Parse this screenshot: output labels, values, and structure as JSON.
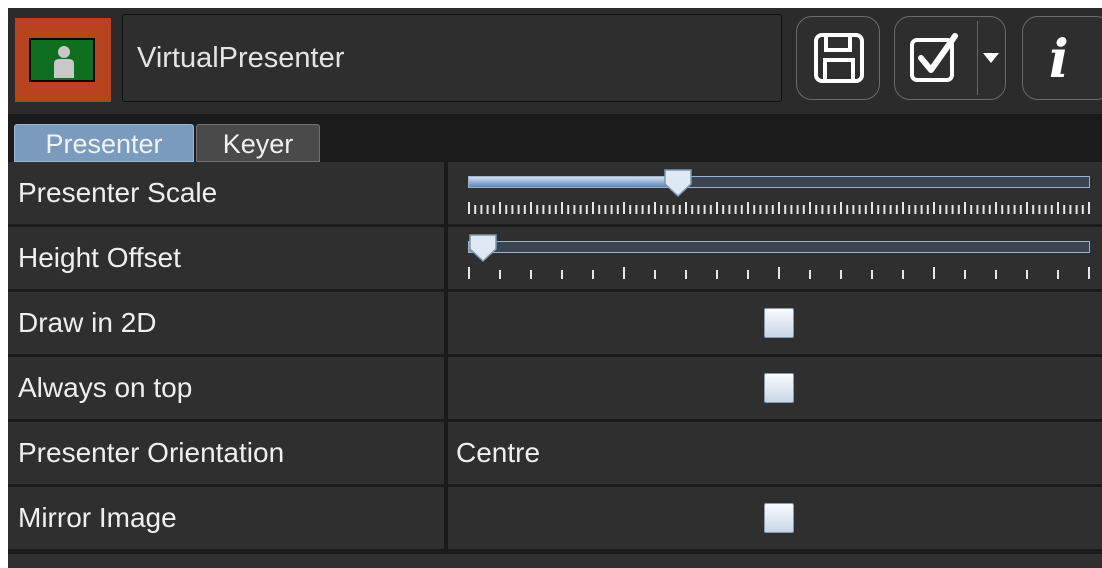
{
  "header": {
    "node_name": "VirtualPresenter",
    "node_icon": "presenter-node-icon",
    "buttons": [
      {
        "name": "save",
        "icon": "floppy-disk-icon"
      },
      {
        "name": "check",
        "icon": "checkbox-checked-icon",
        "dropdown_icon": "caret-down-icon"
      },
      {
        "name": "info",
        "icon": "info-icon",
        "glyph": "i"
      }
    ]
  },
  "tabs": [
    {
      "label": "Presenter",
      "active": true
    },
    {
      "label": "Keyer",
      "active": false
    }
  ],
  "properties": {
    "presenter_scale": {
      "label": "Presenter Scale",
      "value_fraction": 0.33
    },
    "height_offset": {
      "label": "Height Offset",
      "value_fraction": 0.0
    },
    "draw_in_2d": {
      "label": "Draw in 2D",
      "checked": false
    },
    "always_on_top": {
      "label": "Always on top",
      "checked": false
    },
    "presenter_orientation": {
      "label": "Presenter Orientation",
      "value": "Centre"
    },
    "mirror_image": {
      "label": "Mirror Image",
      "checked": false
    }
  },
  "colors": {
    "icon_background": "#b8431f",
    "icon_screen": "#0f6e1f",
    "active_tab": "#7a9bbd",
    "panel": "#2f2f2f"
  }
}
